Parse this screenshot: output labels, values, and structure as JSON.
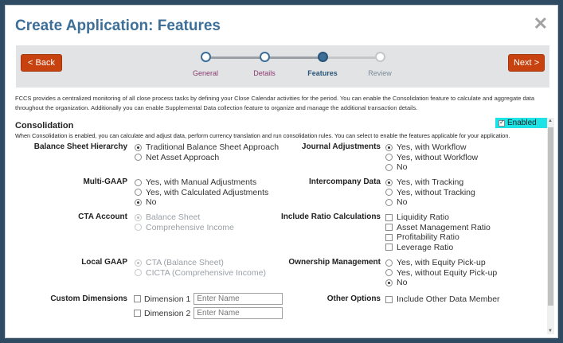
{
  "dialog": {
    "title": "Create Application:  Features",
    "close_glyph": "✕"
  },
  "train": {
    "back_label": "< Back",
    "next_label": "Next >",
    "steps": [
      {
        "label": "General",
        "state": "done"
      },
      {
        "label": "Details",
        "state": "done"
      },
      {
        "label": "Features",
        "state": "current"
      },
      {
        "label": "Review",
        "state": "future"
      }
    ]
  },
  "description": "FCCS provides a centralized monitoring of all close process tasks by defining your Close Calendar activities for the period. You can enable the Consolidation feature to calculate and aggregate data throughout the organization. Additionally you can enable Supplemental Data collection feature to organize and manage the additional transaction details.",
  "consolidation": {
    "heading": "Consolidation",
    "enabled_label": "Enabled",
    "enabled_checked": true,
    "description": "When Consolidation is enabled, you can calculate and adjust data, perform currency translation and run consolidation rules. You can select to enable the features applicable for your application."
  },
  "left": {
    "balance_sheet": {
      "label": "Balance Sheet Hierarchy",
      "options": [
        "Traditional Balance Sheet Approach",
        "Net Asset Approach"
      ],
      "selected": 0
    },
    "multi_gaap": {
      "label": "Multi-GAAP",
      "options": [
        "Yes, with Manual Adjustments",
        "Yes, with Calculated Adjustments",
        "No"
      ],
      "selected": 2
    },
    "cta": {
      "label": "CTA Account",
      "options": [
        "Balance Sheet",
        "Comprehensive Income"
      ],
      "selected": 0,
      "disabled": true
    },
    "local_gaap": {
      "label": "Local GAAP",
      "options": [
        "CTA (Balance Sheet)",
        "CICTA (Comprehensive Income)"
      ],
      "selected": 0,
      "disabled": true
    },
    "custom_dims": {
      "label": "Custom Dimensions",
      "items": [
        {
          "label": "Dimension 1",
          "placeholder": "Enter Name"
        },
        {
          "label": "Dimension 2",
          "placeholder": "Enter Name"
        }
      ]
    }
  },
  "right": {
    "journal": {
      "label": "Journal Adjustments",
      "options": [
        "Yes, with Workflow",
        "Yes, without Workflow",
        "No"
      ],
      "selected": 0
    },
    "intercompany": {
      "label": "Intercompany Data",
      "options": [
        "Yes, with Tracking",
        "Yes, without Tracking",
        "No"
      ],
      "selected": 0
    },
    "ratios": {
      "label": "Include Ratio Calculations",
      "options": [
        "Liquidity Ratio",
        "Asset Management Ratio",
        "Profitability Ratio",
        "Leverage Ratio"
      ]
    },
    "ownership": {
      "label": "Ownership Management",
      "options": [
        "Yes, with Equity Pick-up",
        "Yes, without Equity Pick-up",
        "No"
      ],
      "selected": 2
    },
    "other": {
      "label": "Other Options",
      "options": [
        "Include Other Data Member"
      ]
    }
  },
  "colors": {
    "accent": "#3d6f98",
    "button": "#c8420f",
    "highlight": "#1de3e6"
  }
}
